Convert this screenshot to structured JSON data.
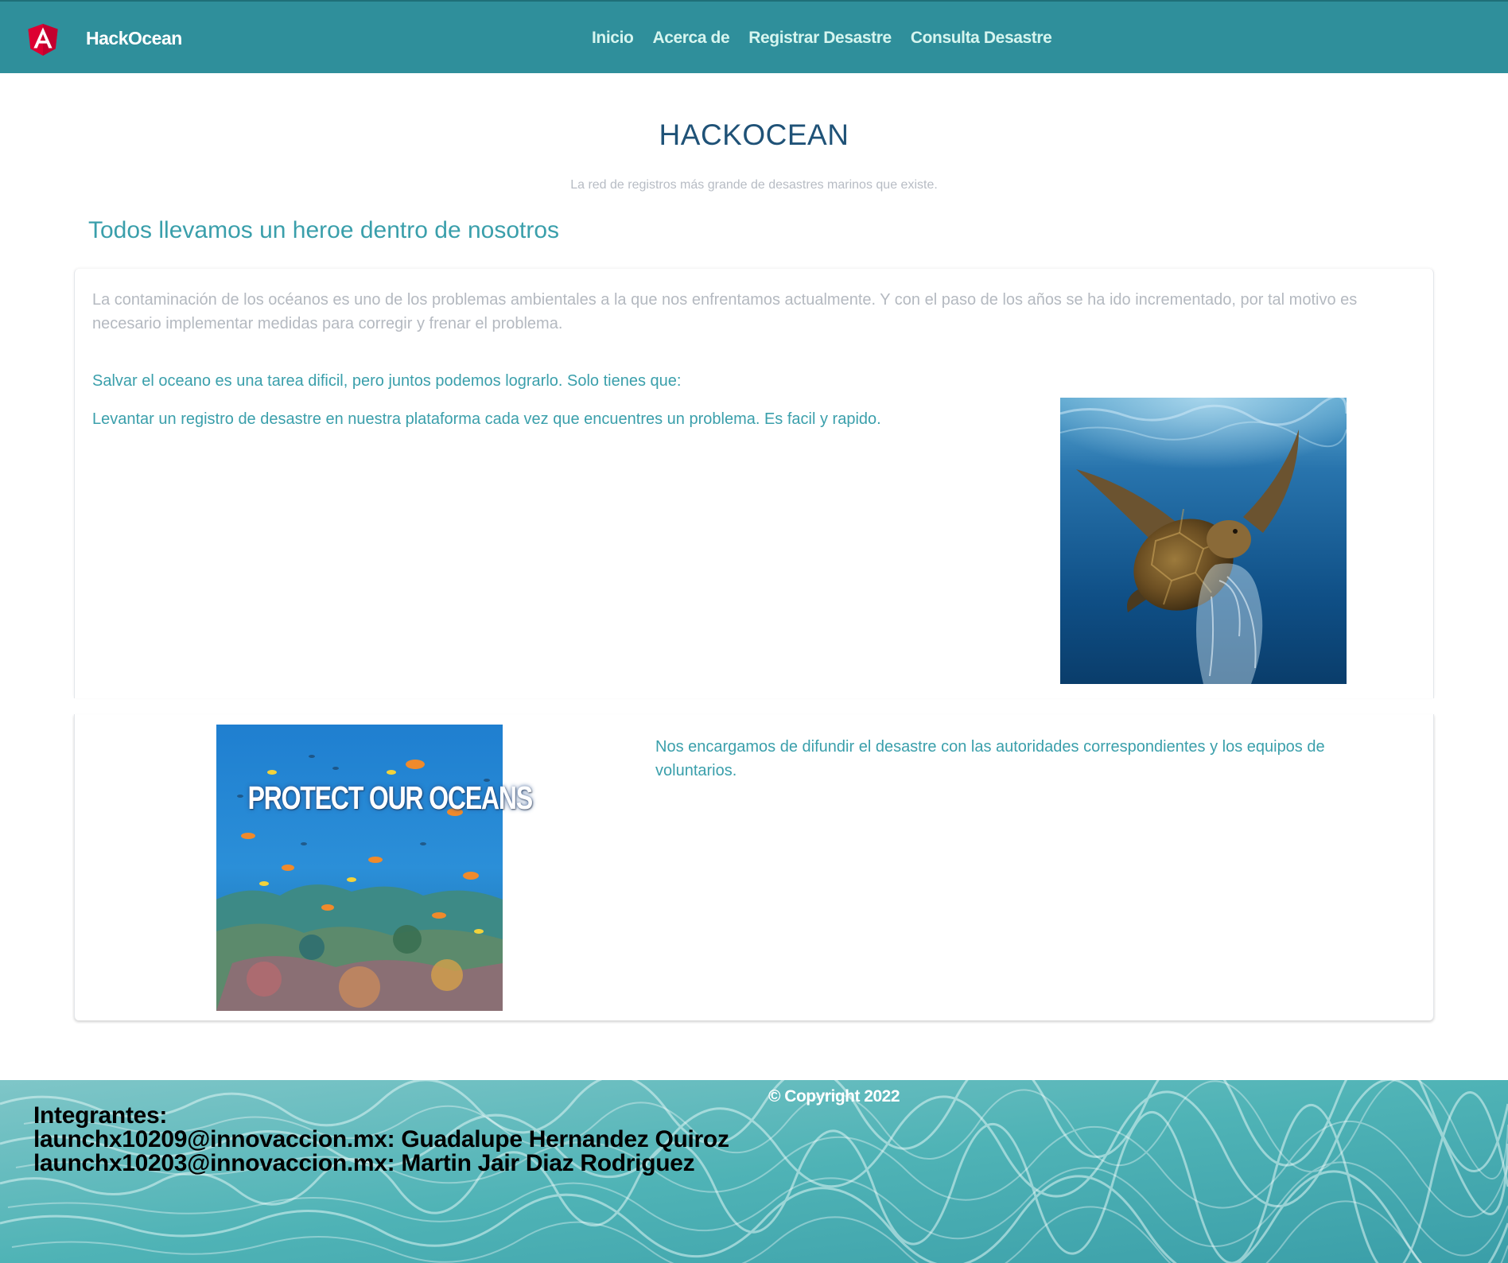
{
  "navbar": {
    "logo_icon": "angular-logo-icon",
    "brand": "HackOcean",
    "links": [
      "Inicio",
      "Acerca de",
      "Registrar Desastre",
      "Consulta Desastre"
    ]
  },
  "header": {
    "title": "HACKOCEAN",
    "subtitle": "La red de registros más grande de desastres marinos que existe."
  },
  "section": {
    "heading": "Todos llevamos un heroe dentro de nosotros",
    "intro": "La contaminación de los océanos es uno de los problemas ambientales a la que nos enfrentamos actualmente. Y con el paso de los años se ha ido incrementado, por tal motivo es necesario implementar medidas para corregir y frenar el problema.",
    "call_to_action": "Salvar el oceano es una tarea dificil, pero juntos podemos lograrlo. Solo tienes que:",
    "register_text": "Levantar un registro de desastre en nuestra plataforma cada vez que encuentres un problema. Es facil y rapido.",
    "spread_text": "Nos encargamos de difundir el desastre con las autoridades correspondientes y los equipos de voluntarios."
  },
  "images": {
    "turtle": "sea-turtle-plastic-bag-image",
    "poster": "protect-our-oceans-image",
    "poster_text": "PROTECT OUR OCEANS"
  },
  "footer": {
    "copyright": "© Copyright 2022",
    "members_title": "Integrantes:",
    "members": [
      "launchx10209@innovaccion.mx: Guadalupe Hernandez Quiroz",
      "launchx10203@innovaccion.mx: Martin Jair Diaz Rodriguez"
    ]
  },
  "colors": {
    "navbar": "#2f8f9b",
    "title": "#1f5277",
    "accent": "#3a9fab",
    "muted_text": "#b4b9c0",
    "angular_red": "#dd0031"
  }
}
